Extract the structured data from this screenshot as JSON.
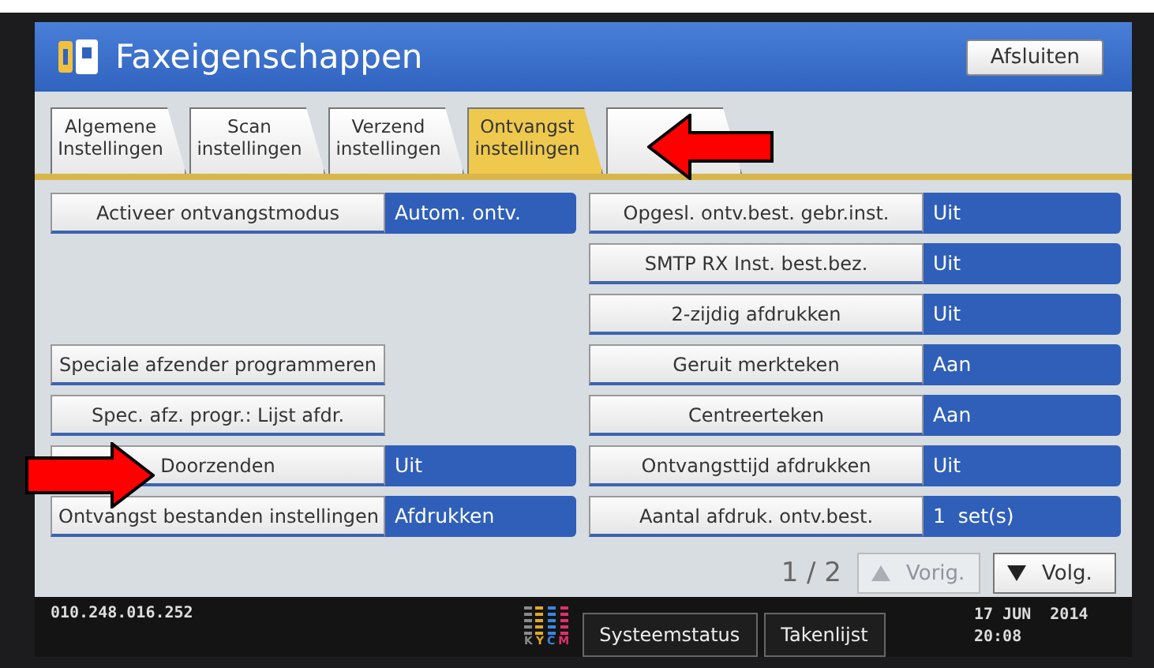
{
  "window": {
    "title": "Faxeigenschappen",
    "close_button": "Afsluiten"
  },
  "tabs": [
    {
      "label": "Algemene Instellingen",
      "selected": false
    },
    {
      "label": "Scan instellingen",
      "selected": false
    },
    {
      "label": "Verzend instellingen",
      "selected": false
    },
    {
      "label": "Ontvangst instellingen",
      "selected": true
    },
    {
      "selected": false
    }
  ],
  "left_settings": [
    {
      "kind": "setting",
      "label": "Activeer ontvangstmodus",
      "value": "Autom. ontv."
    },
    {
      "kind": "blank"
    },
    {
      "kind": "blank"
    },
    {
      "kind": "button",
      "label": "Speciale afzender programmeren"
    },
    {
      "kind": "button",
      "label": "Spec. afz. progr.: Lijst afdr."
    },
    {
      "kind": "setting",
      "label": "Doorzenden",
      "value": "Uit"
    },
    {
      "kind": "setting",
      "label": "Ontvangst bestanden instellingen",
      "value": "Afdrukken"
    }
  ],
  "right_settings": [
    {
      "kind": "setting",
      "label": "Opgesl. ontv.best. gebr.inst.",
      "value": "Uit"
    },
    {
      "kind": "setting",
      "label": "SMTP RX Inst. best.bez.",
      "value": "Uit"
    },
    {
      "kind": "setting",
      "label": "2-zijdig afdrukken",
      "value": "Uit"
    },
    {
      "kind": "setting",
      "label": "Geruit merkteken",
      "value": "Aan"
    },
    {
      "kind": "setting",
      "label": "Centreerteken",
      "value": "Aan"
    },
    {
      "kind": "setting",
      "label": "Ontvangsttijd afdrukken",
      "value": "Uit"
    },
    {
      "kind": "setting",
      "label": "Aantal afdruk. ontv.best.",
      "value": "1  set(s)"
    }
  ],
  "pager": {
    "page": "1 / 2",
    "buttons": [
      {
        "kind": "up",
        "label": "Vorig.",
        "disabled": true
      },
      {
        "kind": "down",
        "label": "Volg.",
        "disabled": false
      }
    ]
  },
  "status_bar": {
    "ip": "010.248.016.252",
    "toner": [
      {
        "letter": "K",
        "color": "#8a8a8a"
      },
      {
        "letter": "Y",
        "color": "#e0a828"
      },
      {
        "letter": "C",
        "color": "#3a86e0"
      },
      {
        "letter": "M",
        "color": "#e0306a"
      }
    ],
    "buttons": [
      "Systeemstatus",
      "Takenlijst"
    ],
    "date": "17 JUN  2014",
    "time": "20:08"
  }
}
